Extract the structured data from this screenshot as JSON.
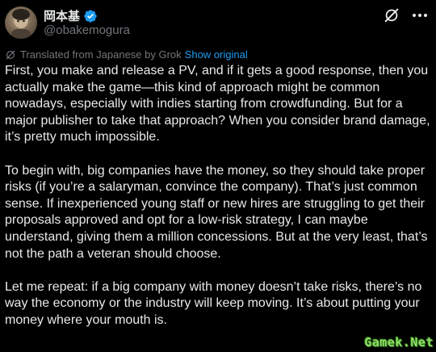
{
  "user": {
    "display_name": "岡本基",
    "handle": "@obakemogura",
    "verified": true,
    "avatar_icon": "avatar"
  },
  "header_actions": {
    "grok_icon": "grok-icon",
    "more_icon": "more-icon"
  },
  "translation": {
    "label": "Translated from Japanese by Grok",
    "show_original": "Show original",
    "link_color": "#1d9bf0"
  },
  "tweet": {
    "paragraphs": [
      "First, you make and release a PV, and if it gets a good response, then you actually make the game—this kind of approach might be common nowadays, especially with indies starting from crowdfunding. But for a major publisher to take that approach? When you consider brand damage, it’s pretty much impossible.",
      "To begin with, big companies have the money, so they should take proper risks (if you’re a salaryman, convince the company). That’s just common sense. If inexperienced young staff or new hires are struggling to get their proposals approved and opt for a low-risk strategy, I can maybe understand, giving them a million concessions. But at the very least, that’s not the path a veteran should choose.",
      "Let me repeat: if a big company with money doesn’t take risks, there’s no way the economy or the industry will keep moving. It’s about putting your money where your mouth is."
    ]
  },
  "watermark": "Gamek.Net",
  "colors": {
    "background": "#000000",
    "text": "#e7e9ea",
    "secondary": "#71767b",
    "verified": "#1d9bf0"
  }
}
